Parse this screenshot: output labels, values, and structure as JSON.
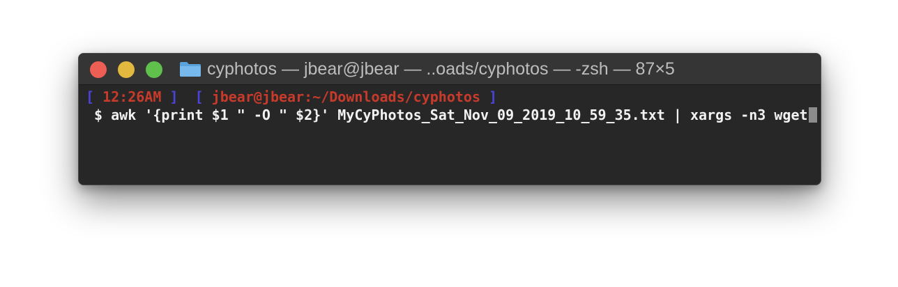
{
  "window": {
    "title": "cyphotos — jbear@jbear — ..oads/cyphotos — -zsh — 87×5",
    "folder_icon": "folder-icon",
    "buttons": {
      "close_color": "#ed5f55",
      "minimize_color": "#e3b83e",
      "maximize_color": "#5fc04c"
    }
  },
  "terminal": {
    "prompt": {
      "open_bracket_1": "[",
      "time": "12:26AM",
      "close_bracket_1": "]",
      "open_bracket_2": "[",
      "user_path": "jbear@jbear:~/Downloads/cyphotos",
      "close_bracket_2": "]"
    },
    "command_line": {
      "symbol": "$",
      "command": "awk '{print $1 \" -O \" $2}' MyCyPhotos_Sat_Nov_09_2019_10_59_35.txt | xargs -n3 wget"
    }
  },
  "colors": {
    "bracket": "#4a45d8",
    "prompt_text": "#c83b2b",
    "command_text": "#f2f2f2",
    "background": "#272727"
  }
}
